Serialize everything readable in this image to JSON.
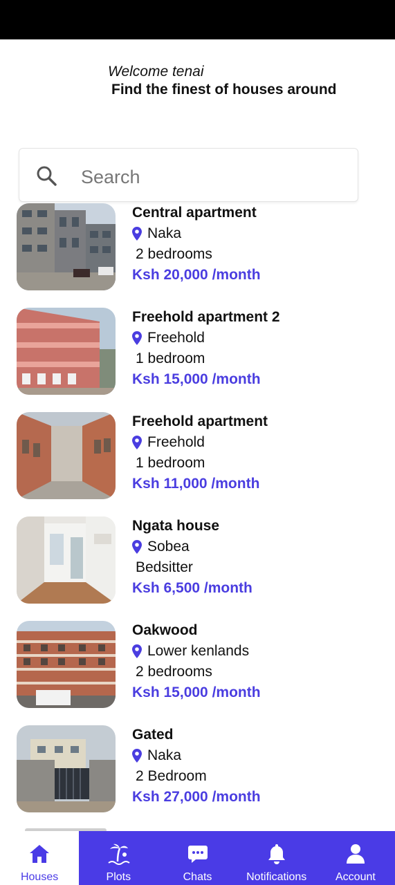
{
  "header": {
    "welcome": "Welcome tenai",
    "tagline": "Find the finest of houses around"
  },
  "search": {
    "placeholder": "Search",
    "value": ""
  },
  "listings": [
    {
      "title": "Central apartment",
      "location": "Naka",
      "bedrooms": "2 bedrooms",
      "price": "Ksh 20,000 /month"
    },
    {
      "title": "Freehold apartment 2",
      "location": "Freehold",
      "bedrooms": "1 bedroom",
      "price": "Ksh 15,000 /month"
    },
    {
      "title": "Freehold apartment",
      "location": "Freehold",
      "bedrooms": "1 bedroom",
      "price": "Ksh 11,000 /month"
    },
    {
      "title": "Ngata house",
      "location": "Sobea",
      "bedrooms": "Bedsitter",
      "price": "Ksh 6,500 /month"
    },
    {
      "title": "Oakwood",
      "location": "Lower kenlands",
      "bedrooms": "2 bedrooms",
      "price": "Ksh 15,000 /month"
    },
    {
      "title": "Gated",
      "location": "Naka",
      "bedrooms": "2 Bedroom",
      "price": "Ksh 27,000 /month"
    }
  ],
  "nav": {
    "items": [
      {
        "label": "Houses",
        "icon": "home-icon",
        "active": true
      },
      {
        "label": "Plots",
        "icon": "beach-icon",
        "active": false
      },
      {
        "label": "Chats",
        "icon": "chat-icon",
        "active": false
      },
      {
        "label": "Notifications",
        "icon": "bell-icon",
        "active": false
      },
      {
        "label": "Account",
        "icon": "user-icon",
        "active": false
      }
    ]
  },
  "colors": {
    "accent": "#4a3de0",
    "nav_background": "#4a3be6",
    "status_bar": "#000000"
  }
}
